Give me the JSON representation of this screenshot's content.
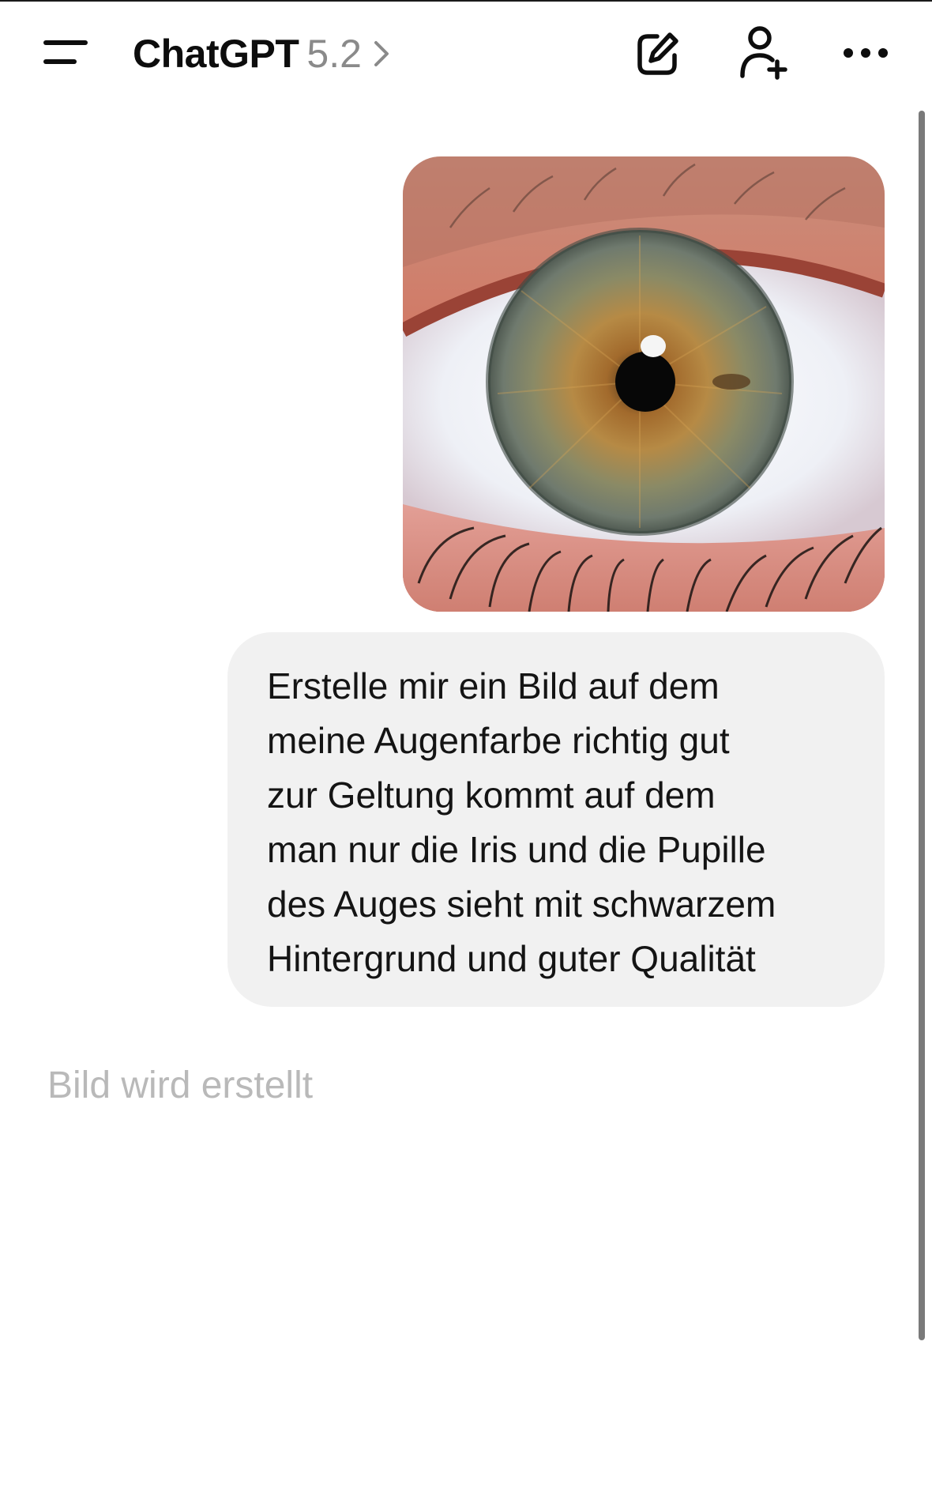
{
  "header": {
    "title": "ChatGPT",
    "version": "5.2",
    "icons": {
      "menu": "menu-icon",
      "chevron": "chevron-right-icon",
      "new_chat": "edit-icon",
      "add_people": "add-user-icon",
      "more": "more-icon"
    }
  },
  "conversation": {
    "user_image": "eye-photo",
    "user_message": "Erstelle mir ein Bild auf dem\nmeine Augenfarbe richtig gut\nzur Geltung kommt auf dem\nman nur die Iris und die Pupille\ndes Auges sieht mit schwarzem\nHintergrund und guter Qualität",
    "assistant_status": "Bild wird erstellt"
  },
  "colors": {
    "bubble_background": "#f1f1f1",
    "status_text": "#b9b9b9",
    "version_text": "#8a8a8a"
  }
}
